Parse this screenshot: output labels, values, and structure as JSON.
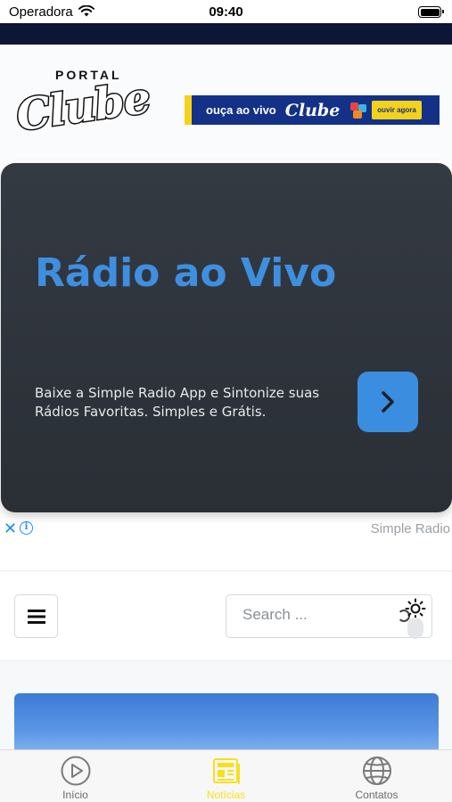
{
  "status_bar": {
    "carrier": "Operadora",
    "time": "09:40"
  },
  "header": {
    "logo_top": "PORTAL",
    "logo_main": "Clube",
    "banner": {
      "text": "ouça ao vivo",
      "brand": "Clube",
      "button": "ouvir agora"
    }
  },
  "ad": {
    "title": "Rádio ao Vivo",
    "body": "Baixe a Simple Radio App e Sintonize suas Rádios Favoritas. Simples e Grátis.",
    "sponsor": "Simple Radio",
    "close_icon": "close-icon",
    "info_icon": "info-icon"
  },
  "nav": {
    "menu_icon": "hamburger-menu-icon",
    "search": {
      "placeholder": "Search ...",
      "value": ""
    },
    "theme_icon": "sun-icon"
  },
  "tabs": [
    {
      "label": "Início",
      "icon": "play-circle-icon",
      "active": false
    },
    {
      "label": "Notícias",
      "icon": "newspaper-icon",
      "active": true
    },
    {
      "label": "Contatos",
      "icon": "globe-icon",
      "active": false
    }
  ],
  "colors": {
    "navy": "#0c1737",
    "ad_accent": "#3b8de0",
    "banner_blue": "#143188",
    "banner_yellow": "#f4d21a",
    "tab_active": "#f7e01a"
  }
}
